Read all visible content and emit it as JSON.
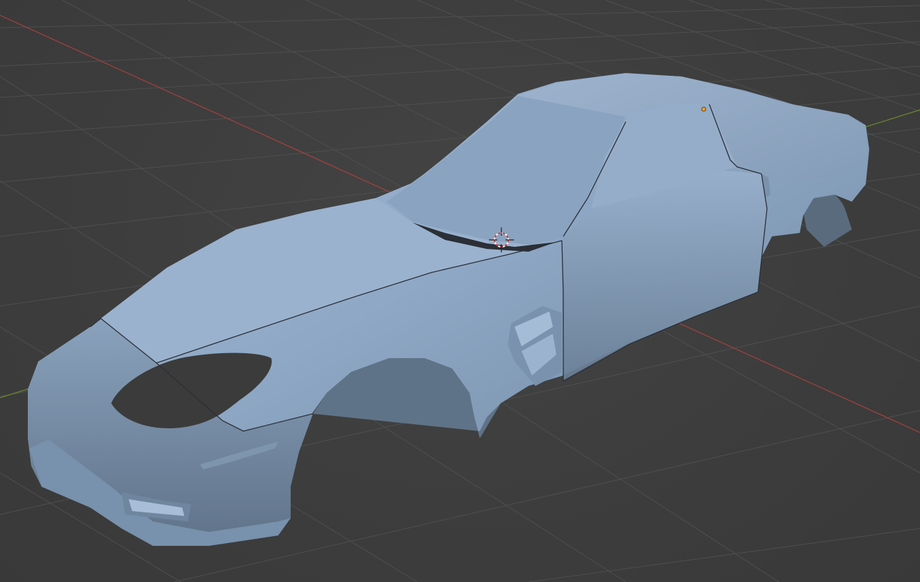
{
  "viewport": {
    "background_color": "#3d3d3d",
    "grid_color": "#4f4f4f",
    "x_axis_color": "#a8403f",
    "y_axis_color": "#6b8c2c"
  },
  "object": {
    "type": "car-body-mesh",
    "base_color": "#8ea8c6",
    "shadow_color": "#6a829e",
    "highlight_color": "#a9c0da",
    "origin_color": "#f0a030"
  },
  "icons": [
    "3d-cursor-icon",
    "object-origin-icon"
  ]
}
